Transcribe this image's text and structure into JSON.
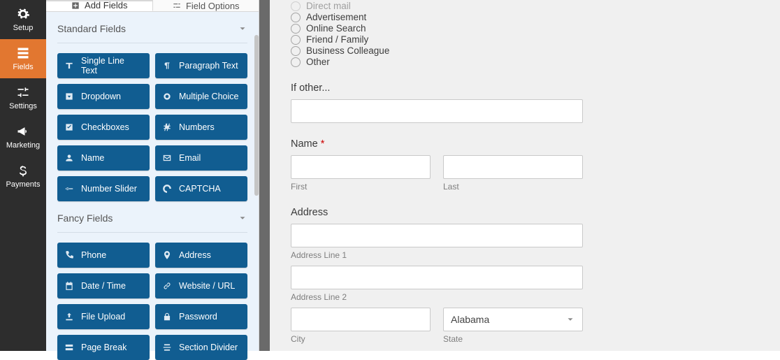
{
  "nav": {
    "items": [
      {
        "label": "Setup",
        "icon": "gear"
      },
      {
        "label": "Fields",
        "icon": "form",
        "active": true
      },
      {
        "label": "Settings",
        "icon": "sliders"
      },
      {
        "label": "Marketing",
        "icon": "bullhorn"
      },
      {
        "label": "Payments",
        "icon": "dollar"
      }
    ]
  },
  "sidebar": {
    "tabs": {
      "add_fields": "Add Fields",
      "field_options": "Field Options"
    },
    "sections": [
      {
        "title": "Standard Fields",
        "fields": [
          {
            "label": "Single Line Text",
            "icon": "text"
          },
          {
            "label": "Paragraph Text",
            "icon": "pilcrow"
          },
          {
            "label": "Dropdown",
            "icon": "caret-down-sq"
          },
          {
            "label": "Multiple Choice",
            "icon": "radio"
          },
          {
            "label": "Checkboxes",
            "icon": "check"
          },
          {
            "label": "Numbers",
            "icon": "hash"
          },
          {
            "label": "Name",
            "icon": "user"
          },
          {
            "label": "Email",
            "icon": "mail"
          },
          {
            "label": "Number Slider",
            "icon": "slider"
          },
          {
            "label": "CAPTCHA",
            "icon": "captcha"
          }
        ]
      },
      {
        "title": "Fancy Fields",
        "fields": [
          {
            "label": "Phone",
            "icon": "phone"
          },
          {
            "label": "Address",
            "icon": "pin"
          },
          {
            "label": "Date / Time",
            "icon": "calendar"
          },
          {
            "label": "Website / URL",
            "icon": "link"
          },
          {
            "label": "File Upload",
            "icon": "upload"
          },
          {
            "label": "Password",
            "icon": "lock"
          },
          {
            "label": "Page Break",
            "icon": "break"
          },
          {
            "label": "Section Divider",
            "icon": "divider"
          }
        ]
      }
    ]
  },
  "form": {
    "radio_options": [
      "Direct mail",
      "Advertisement",
      "Online Search",
      "Friend / Family",
      "Business Colleague",
      "Other"
    ],
    "if_other": {
      "label": "If other..."
    },
    "name": {
      "label": "Name",
      "required": "*",
      "first_sub": "First",
      "last_sub": "Last"
    },
    "address": {
      "label": "Address",
      "line1_sub": "Address Line 1",
      "line2_sub": "Address Line 2",
      "city_sub": "City",
      "state_sub": "State",
      "state_value": "Alabama"
    }
  }
}
